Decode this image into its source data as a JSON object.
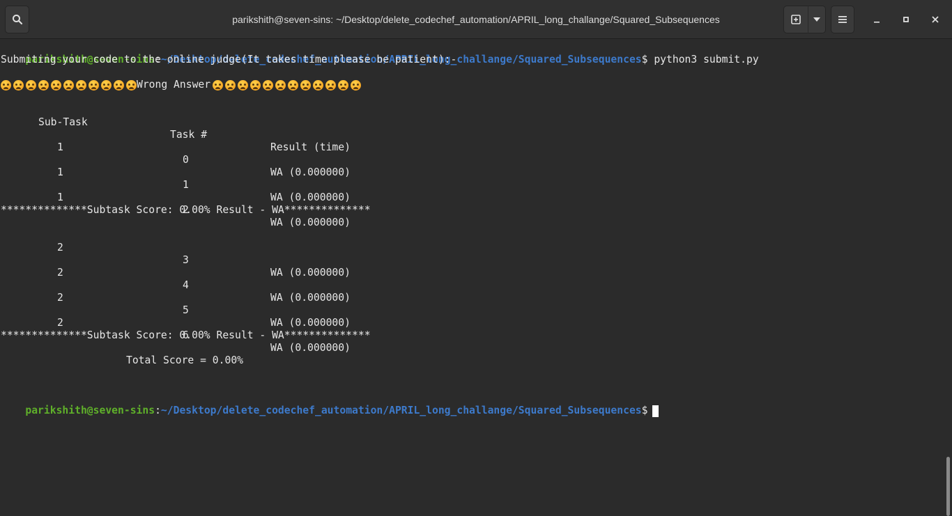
{
  "window": {
    "title": "parikshith@seven-sins: ~/Desktop/delete_codechef_automation/APRIL_long_challange/Squared_Subsequences"
  },
  "icons": {
    "search": "search-icon",
    "new_tab": "new-tab-icon",
    "dropdown": "chevron-down-icon",
    "menu": "hamburger-menu-icon",
    "minimize": "minimize-icon",
    "maximize": "maximize-icon",
    "close": "close-icon",
    "emoji": "frowning-face-emoji"
  },
  "colors": {
    "prompt_user": "#5fb02a",
    "prompt_path": "#3d7acb",
    "background": "#2b2b2b"
  },
  "prompt": {
    "user": "parikshith@seven-sins",
    "separator": ":",
    "path": "~/Desktop/delete_codechef_automation/APRIL_long_challange/Squared_Subsequences",
    "symbol": "$"
  },
  "command": "python3 submit.py",
  "submitting_msg": "Submiting your code to the online judge(It takes time please be patient):-",
  "verdict": {
    "text": "Wrong Answer",
    "emoji_left_count": 11,
    "emoji_right_count": 12
  },
  "table": {
    "headers": [
      "Sub-Task",
      "Task #",
      "Result (time)"
    ],
    "rows": [
      {
        "subtask": "1",
        "task": "0",
        "result": "WA (0.000000)"
      },
      {
        "subtask": "1",
        "task": "1",
        "result": "WA (0.000000)"
      },
      {
        "subtask": "1",
        "task": "2",
        "result": "WA (0.000000)"
      },
      {
        "subtask": "2",
        "task": "3",
        "result": "WA (0.000000)"
      },
      {
        "subtask": "2",
        "task": "4",
        "result": "WA (0.000000)"
      },
      {
        "subtask": "2",
        "task": "5",
        "result": "WA (0.000000)"
      },
      {
        "subtask": "2",
        "task": "6",
        "result": "WA (0.000000)"
      }
    ],
    "subtask_summaries": [
      "**************Subtask Score: 0.00% Result - WA**************",
      "**************Subtask Score: 0.00% Result - WA**************"
    ]
  },
  "total_score": "Total Score = 0.00%"
}
